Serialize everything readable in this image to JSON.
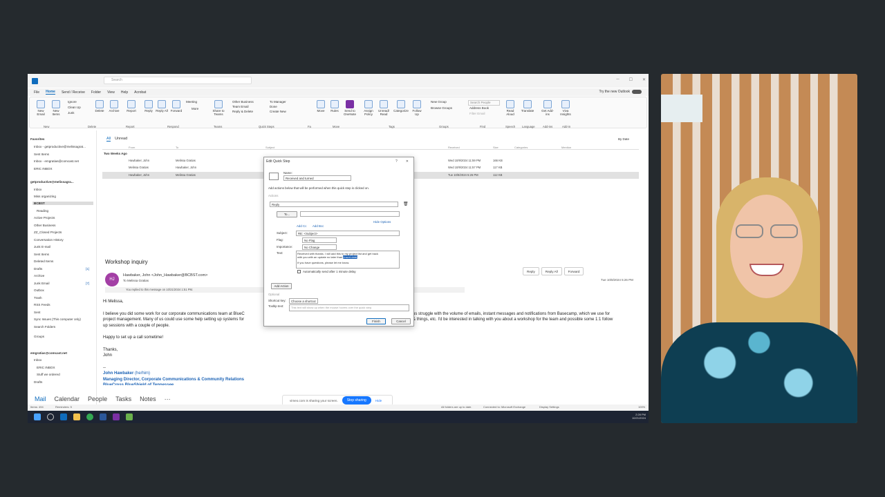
{
  "window": {
    "search_placeholder": "Search",
    "try_new": "Try the new Outlook"
  },
  "menu": [
    "File",
    "Home",
    "Send / Receive",
    "Folder",
    "View",
    "Help",
    "Acrobat"
  ],
  "ribbon": {
    "new_email": "New Email",
    "new_items": "New Items",
    "ignore": "Ignore",
    "clean_up": "Clean Up",
    "junk": "Junk",
    "delete": "Delete",
    "archive": "Archive",
    "report": "Report",
    "reply": "Reply",
    "reply_all": "Reply All",
    "forward": "Forward",
    "meeting": "Meeting",
    "more": "More",
    "share_teams": "Share to Teams",
    "qs_other_business": "Other Business",
    "qs_team_email": "Team Email",
    "qs_reply_delete": "Reply & Delete",
    "qs_to_manager": "To Manager",
    "qs_done": "Done",
    "qs_create_new": "Create New",
    "move": "Move",
    "rules": "Rules",
    "send_onenote": "Send to OneNote",
    "assign_policy": "Assign Policy",
    "unread_read": "Unread/ Read",
    "categorize": "Categorize",
    "follow_up": "Follow Up",
    "new_group": "New Group",
    "browse_groups": "Browse Groups",
    "search_people": "Search People",
    "address_book": "Address Book",
    "filter_email": "Filter Email",
    "read_aloud": "Read Aloud",
    "translate": "Translate",
    "get_addins": "Get Add-ins",
    "viva_insights": "Viva Insights",
    "groups": [
      "New",
      "Delete",
      "Report",
      "Respond",
      "Teams",
      "Quick Steps",
      "Fa",
      "Move",
      "Tags",
      "Groups",
      "Find",
      "Speech",
      "Language",
      "Add-ins",
      "Add-in"
    ]
  },
  "sidebar": {
    "items": [
      "Favorites",
      "Inbox - getproductive@melissagrat...",
      "Sent Items",
      "Inbox - emgratias@comcast.net",
      "ERIC INBOX",
      "getproductive@melissagra...",
      "Inbox",
      "Miss organizing",
      "BCBST",
      "Reading",
      "Active Projects",
      "Other Business",
      "ZZ_Closed Projects",
      "Conversation History",
      "Junk E-mail",
      "Sent Items",
      "Deleted Items",
      "Drafts",
      "Archive",
      "Junk Email",
      "Outbox",
      "Trash",
      "RSS Feeds",
      "Sent",
      "Sync Issues (This computer only)",
      "Search Folders",
      "Groups",
      "emgratias@comcast.net",
      "Inbox",
      "ERIC INBOX",
      "Stuff we ordered",
      "Drafts"
    ],
    "drafts_count": "[1]",
    "junk_count": "[7]"
  },
  "list": {
    "tab_all": "All",
    "tab_unread": "Unread",
    "by_date": "By Date",
    "columns": [
      "From",
      "To",
      "Subject",
      "Received",
      "Size",
      "Categories",
      "Mention"
    ],
    "group": "Two Weeks Ago",
    "rows": [
      {
        "from": "Hawbaker, John",
        "to": "Melissa Gratias",
        "received": "Wed 10/9/2024 11:59 PM",
        "size": "166 KB"
      },
      {
        "from": "Melissa Gratias",
        "to": "Hawbaker, John",
        "received": "Wed 10/9/2024 11:57 PM",
        "size": "117 KB"
      },
      {
        "from": "Hawbaker, John",
        "to": "Melissa Gratias",
        "received": "Tue 10/8/2024 5:26 PM",
        "size": "112 KB"
      }
    ]
  },
  "reading": {
    "subject": "Workshop inquiry",
    "initials": "HJ",
    "from": "Hawbaker, John <John_Hawbaker@BCBST.com>",
    "to": "To  Melissa Gratias",
    "replied": "You replied to this message on 10/21/2024 1:51 PM.",
    "reply": "Reply",
    "reply_all": "Reply All",
    "forward": "Forward",
    "date": "Tue 10/8/2024 5:26 PM",
    "greeting": "Hi Melissa,",
    "para1a": "I believe you did some work for our corporate communications team at BlueC",
    "para1b": "us struggle with the volume of emails, instant messages and notifications from Basecamp, which we use for",
    "para2a": "project management. Many of us could use some help setting up systems for",
    "para2b": "& things, etc. I'd be interested in talking with you about a workshop for the team and possible some 1:1 follow",
    "para3": "up sessions with a couple of people.",
    "para4": "Happy to set up a call sometime!",
    "thanks": "Thanks,",
    "name": "John",
    "dashes": "--",
    "sig_name": "John Hawbaker",
    "sig_pron": "(he/him)",
    "sig_title": "Managing Director, Corporate Communications & Community Relations",
    "sig_company": "BlueCross BlueShield of Tennessee"
  },
  "nav": [
    "Mail",
    "Calendar",
    "People",
    "Tasks",
    "Notes",
    "···"
  ],
  "share": {
    "text": "vimeo.com is sharing your screen.",
    "stop": "Stop sharing",
    "hide": "Hide"
  },
  "status": {
    "items": "Items: 494",
    "reminders": "Reminders: 5",
    "uptodate": "All folders are up to date.",
    "connected": "Connected to: Microsoft Exchange",
    "display": "Display Settings",
    "zoom": "100%"
  },
  "tray": {
    "time": "2:28 PM",
    "date": "10/21/2024"
  },
  "dialog": {
    "title": "Edit Quick Step",
    "name_label": "Name:",
    "name_value": "Received and turned",
    "desc": "Add actions below that will be performed when this quick step is clicked on.",
    "actions_label": "Actions",
    "action_value": "Reply",
    "to_button": "To...",
    "hide_options": "Hide Options",
    "add_cc": "Add Cc",
    "add_bcc": "Add Bcc",
    "subject_label": "Subject:",
    "subject_value": "RE: <Subject>",
    "flag_label": "Flag:",
    "flag_value": "No Flag",
    "importance_label": "Importance:",
    "importance_value": "No Change",
    "text_label": "Text:",
    "text_line1": "Received with thanks. I will add this to my project list and get back",
    "text_line2": "with you with an update no later than",
    "text_selected": "[insert.date]",
    "text_line3": "If you have questions, please let me know.",
    "auto_send": "Automatically send after 1 minute delay",
    "add_action": "Add Action",
    "optional": "Optional",
    "shortcut_label": "Shortcut key:",
    "shortcut_value": "Choose a shortcut",
    "tooltip_label": "Tooltip text:",
    "tooltip_value": "This text will show up when the mouse hovers over the quick step.",
    "finish": "Finish",
    "cancel": "Cancel"
  },
  "colors": {
    "accent": "#0f6cbd",
    "stop_sharing": "#1677ff",
    "avatar": "#a33fa5",
    "signature": "#1b62b5"
  }
}
